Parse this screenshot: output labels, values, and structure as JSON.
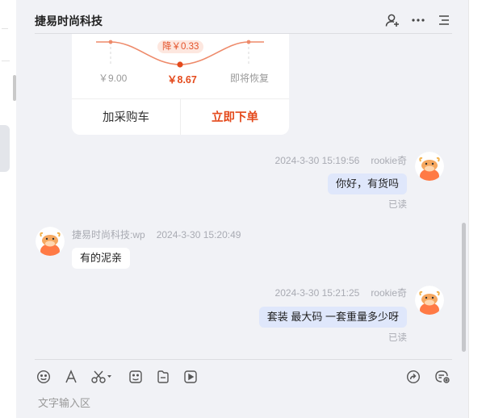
{
  "header": {
    "title": "捷易时尚科技",
    "icons": [
      "add-contact-icon",
      "more-icon",
      "list-icon"
    ]
  },
  "product_card": {
    "drop_badge": "降￥0.33",
    "price_before": "￥9.00",
    "price_now": "￥8.67",
    "price_after": "即将恢复",
    "add_cart_label": "加采购车",
    "buy_now_label": "立即下单",
    "accent_color": "#e44a1c"
  },
  "messages": [
    {
      "direction": "out",
      "time": "2024-3-30 15:19:56",
      "sender": "rookie奇",
      "text": "你好，有货吗",
      "status": "已读"
    },
    {
      "direction": "in",
      "sender": "捷易时尚科技:wp",
      "time": "2024-3-30 15:20:49",
      "text": "有的泥亲"
    },
    {
      "direction": "out",
      "time": "2024-3-30 15:21:25",
      "sender": "rookie奇",
      "text": "套装 最大码 一套重量多少呀",
      "status": "已读"
    }
  ],
  "toolbar": {
    "left_icons": [
      "emoji-icon",
      "font-icon",
      "scissors-icon",
      "sticker-icon",
      "file-icon",
      "video-icon"
    ],
    "right_icons": [
      "forward-icon",
      "chat-settings-icon"
    ]
  },
  "input": {
    "placeholder": "文字输入区",
    "value": ""
  }
}
